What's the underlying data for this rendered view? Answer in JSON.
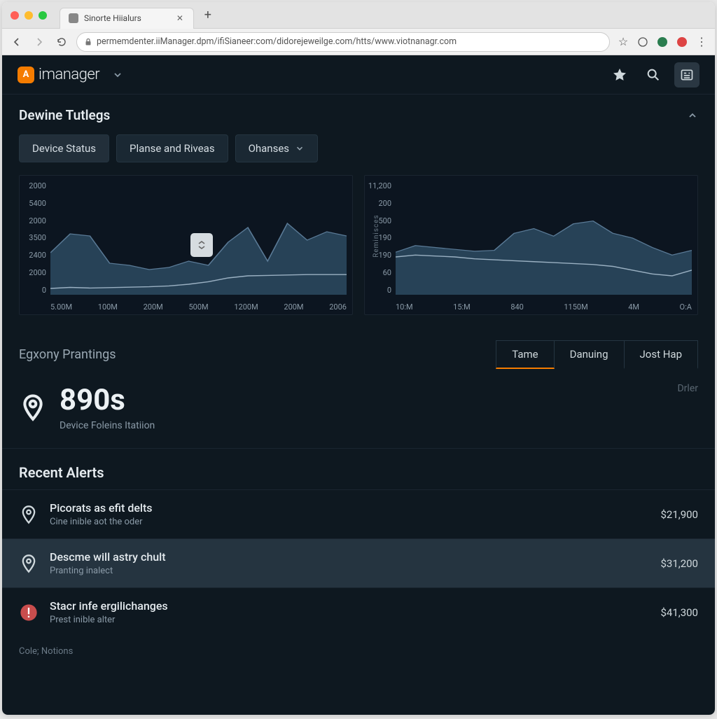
{
  "browser": {
    "tab_title": "Sinorte Hiialurs",
    "url": "permemdenter.iiManager.dpm/ifiSianeer:com/didorejeweilge.com/htts/www.viotnanagr.com"
  },
  "app": {
    "brand_letter": "A",
    "brand_text": "imanager"
  },
  "section": {
    "title": "Dewine Tutlegs",
    "tabs": [
      {
        "label": "Device Status"
      },
      {
        "label": "Planse and Riveas"
      },
      {
        "label": "Ohanses"
      }
    ]
  },
  "chart_data": [
    {
      "type": "area",
      "yticks": [
        "2000",
        "5400",
        "2000",
        "3500",
        "2400",
        "2000",
        "0"
      ],
      "xticks": [
        "5.00M",
        "100M",
        "200M",
        "500M",
        "1200M",
        "200M",
        "2006"
      ],
      "series": [
        {
          "name": "fill",
          "values": [
            2000,
            2900,
            2800,
            1500,
            1400,
            1200,
            1300,
            1600,
            1400,
            2500,
            3200,
            1600,
            3400,
            2600,
            3000,
            2800
          ]
        },
        {
          "name": "line",
          "values": [
            300,
            350,
            320,
            340,
            360,
            380,
            420,
            500,
            620,
            800,
            900,
            920,
            940,
            960,
            960,
            960
          ]
        }
      ],
      "ylim": [
        0,
        5400
      ]
    },
    {
      "type": "area",
      "ylabel": "Reminisces",
      "yticks": [
        "11,200",
        "200",
        "500",
        "190",
        "190",
        "60",
        "0"
      ],
      "xticks": [
        "10:M",
        "15:M",
        "840",
        "1150M",
        "4M",
        "O:A"
      ],
      "series": [
        {
          "name": "fill",
          "values": [
            450,
            520,
            500,
            480,
            460,
            470,
            650,
            700,
            620,
            750,
            780,
            650,
            600,
            500,
            420,
            470
          ]
        },
        {
          "name": "line",
          "values": [
            400,
            420,
            410,
            400,
            380,
            370,
            360,
            350,
            340,
            330,
            320,
            300,
            260,
            220,
            200,
            260
          ]
        }
      ],
      "ylim": [
        0,
        1200
      ]
    }
  ],
  "subsection": {
    "title": "Egxony Prantings",
    "tabs": [
      "Tame",
      "Danuing",
      "Jost Hap"
    ],
    "active": 0
  },
  "metric": {
    "value": "890s",
    "sub": "Device Foleins Itatiion",
    "right": "Drler"
  },
  "alerts": {
    "title": "Recent Alerts",
    "items": [
      {
        "title": "Picorats as efit delts",
        "sub": "Cine inible aot the oder",
        "amount": "$21,900",
        "hl": false,
        "icon": "pin"
      },
      {
        "title": "Descme will astry chult",
        "sub": "Pranting inalect",
        "amount": "$31,200",
        "hl": true,
        "icon": "pin"
      },
      {
        "title": "Stacr infe ergilichanges",
        "sub": "Prest inible alter",
        "amount": "$41,300",
        "hl": false,
        "icon": "warn"
      }
    ],
    "footer": "Cole; Notions"
  }
}
